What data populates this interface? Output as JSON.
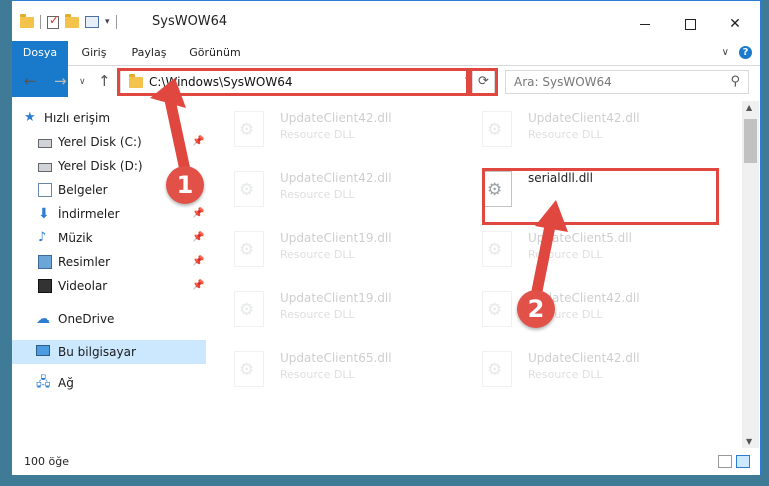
{
  "window": {
    "title": "SysWOW64",
    "controls": {
      "minimize": "minimize",
      "maximize": "maximize",
      "close": "✕"
    }
  },
  "ribbon": {
    "tabs": [
      "Dosya",
      "Giriş",
      "Paylaş",
      "Görünüm"
    ],
    "expand_glyph": "∨",
    "help_glyph": "?"
  },
  "address": {
    "path": "C:\\Windows\\SysWOW64",
    "search_placeholder": "Ara: SysWOW64"
  },
  "sidebar": {
    "quick_access": "Hızlı erişim",
    "items": [
      {
        "label": "Yerel Disk (C:)",
        "icon": "drive-icon",
        "pinned": true
      },
      {
        "label": "Yerel Disk (D:)",
        "icon": "drive-icon",
        "pinned": true
      },
      {
        "label": "Belgeler",
        "icon": "documents-icon",
        "pinned": true
      },
      {
        "label": "İndirmeler",
        "icon": "downloads-icon",
        "pinned": true
      },
      {
        "label": "Müzik",
        "icon": "music-icon",
        "pinned": true
      },
      {
        "label": "Resimler",
        "icon": "pictures-icon",
        "pinned": true
      },
      {
        "label": "Videolar",
        "icon": "videos-icon",
        "pinned": true
      }
    ],
    "onedrive": "OneDrive",
    "this_pc": "Bu bilgisayar",
    "network": "Ağ"
  },
  "files": [
    {
      "name": "UpdateClient42.dll",
      "type": "Resource DLL",
      "faded": true
    },
    {
      "name": "UpdateClient42.dll",
      "type": "Resource DLL",
      "faded": true
    },
    {
      "name": "UpdateClient42.dll",
      "type": "Resource DLL",
      "faded": true
    },
    {
      "name": "serialdll.dll",
      "type": "",
      "faded": false
    },
    {
      "name": "UpdateClient19.dll",
      "type": "Resource DLL",
      "faded": true
    },
    {
      "name": "UpdateClient5.dll",
      "type": "Resource DLL",
      "faded": true
    },
    {
      "name": "UpdateClient19.dll",
      "type": "Resource DLL",
      "faded": true
    },
    {
      "name": "UpdateClient42.dll",
      "type": "Resource DLL",
      "faded": true
    },
    {
      "name": "UpdateClient65.dll",
      "type": "Resource DLL",
      "faded": true
    },
    {
      "name": "UpdateClient42.dll",
      "type": "Resource DLL",
      "faded": true
    }
  ],
  "status": {
    "item_count": "100 öğe"
  },
  "annotations": {
    "step1": "1",
    "step2": "2",
    "color": "#e0483f"
  }
}
